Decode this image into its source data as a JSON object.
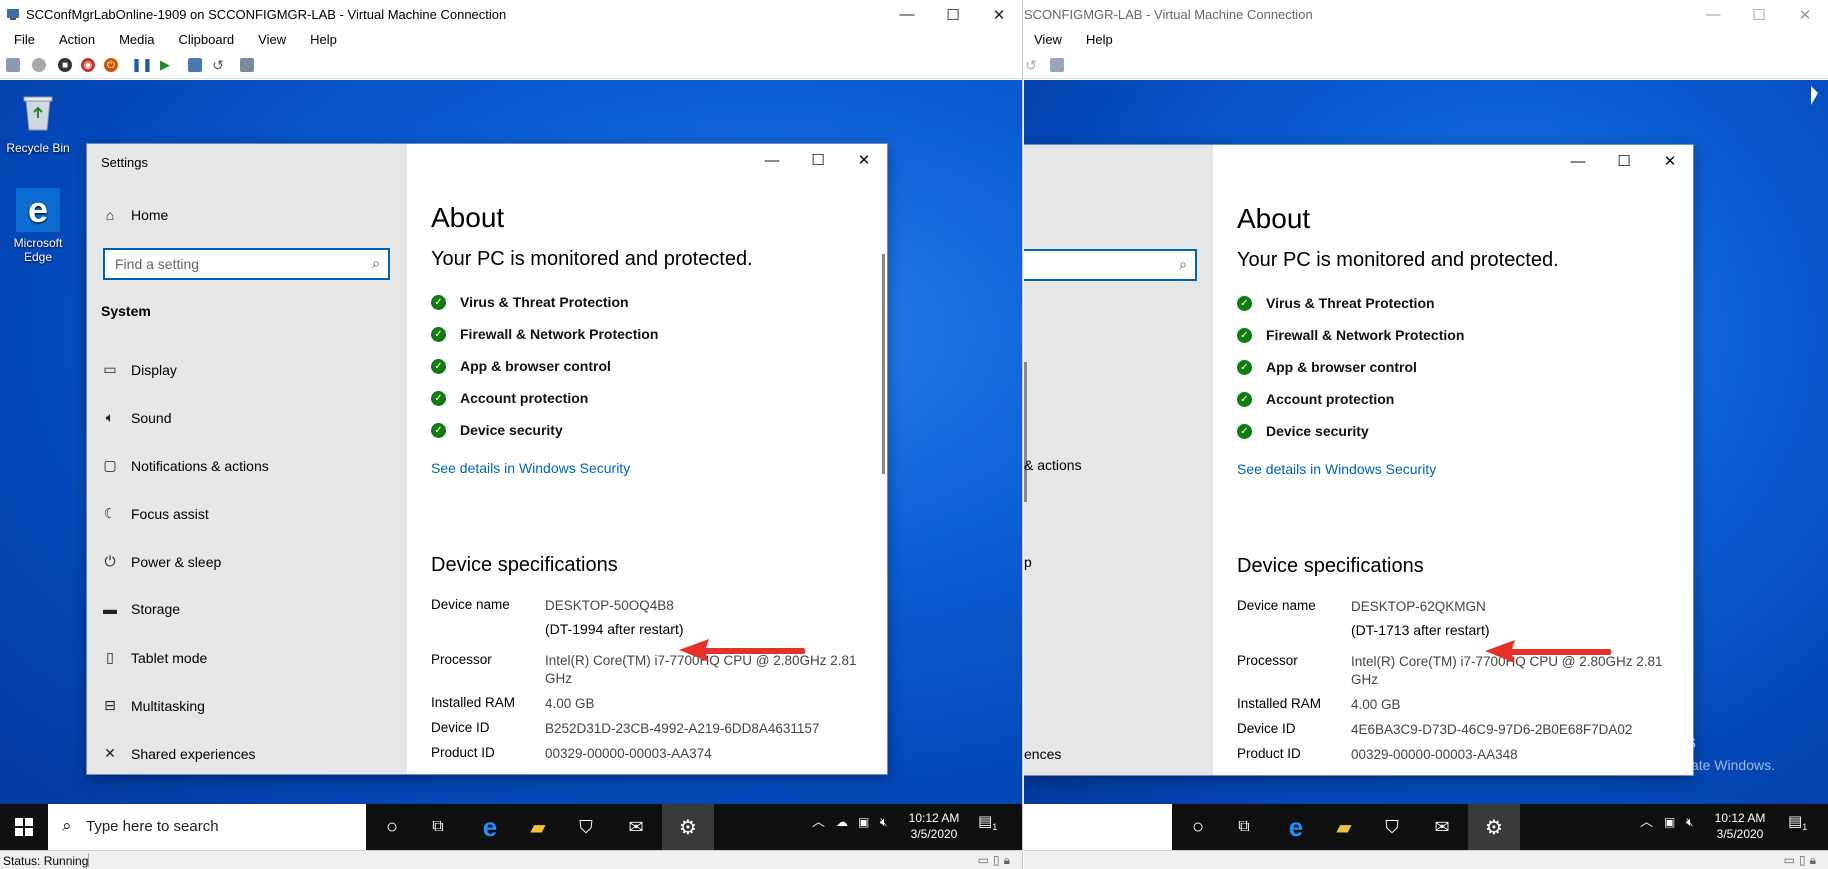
{
  "left_vm": {
    "window_title": "SCConfMgrLabOnline-1909 on SCCONFIGMGR-LAB - Virtual Machine Connection",
    "menu": [
      "File",
      "Action",
      "Media",
      "Clipboard",
      "View",
      "Help"
    ],
    "desktop_icons": [
      {
        "label_line1": "Recycle Bin",
        "label_line2": "",
        "icon": "recycle-bin-icon"
      },
      {
        "label_line1": "Microsoft",
        "label_line2": "Edge",
        "icon": "edge-icon"
      }
    ],
    "settings": {
      "app_title": "Settings",
      "home": "Home",
      "search_placeholder": "Find a setting",
      "section": "System",
      "nav": [
        {
          "label": "Display",
          "icon": "monitor-icon"
        },
        {
          "label": "Sound",
          "icon": "speaker-icon"
        },
        {
          "label": "Notifications & actions",
          "icon": "notification-icon"
        },
        {
          "label": "Focus assist",
          "icon": "moon-icon"
        },
        {
          "label": "Power & sleep",
          "icon": "power-icon"
        },
        {
          "label": "Storage",
          "icon": "storage-icon"
        },
        {
          "label": "Tablet mode",
          "icon": "tablet-icon"
        },
        {
          "label": "Multitasking",
          "icon": "multitasking-icon"
        },
        {
          "label": "Shared experiences",
          "icon": "shared-icon"
        }
      ],
      "about_title": "About",
      "protection_heading": "Your PC is monitored and protected.",
      "protections": [
        "Virus & Threat Protection",
        "Firewall & Network Protection",
        "App & browser control",
        "Account protection",
        "Device security"
      ],
      "security_link": "See details in Windows Security",
      "specs_heading": "Device specifications",
      "specs": {
        "device_name_label": "Device name",
        "device_name": "DESKTOP-50OQ4B8",
        "device_note": "(DT-1994 after restart)",
        "processor_label": "Processor",
        "processor_line1": "Intel(R) Core(TM) i7-7700HQ CPU @ 2.80GHz   2.81",
        "processor_line2": "GHz",
        "ram_label": "Installed RAM",
        "ram": "4.00 GB",
        "device_id_label": "Device ID",
        "device_id": "B252D31D-23CB-4992-A219-6DD8A4631157",
        "product_id_label": "Product ID",
        "product_id": "00329-00000-00003-AA374"
      }
    },
    "taskbar": {
      "search_placeholder": "Type here to search",
      "time": "10:12 AM",
      "date": "3/5/2020",
      "notif_count": "1"
    },
    "status": "Status: Running"
  },
  "right_vm": {
    "window_title": "SCONFIGMGR-LAB - Virtual Machine Connection",
    "menu": [
      "View",
      "Help"
    ],
    "settings": {
      "nav_partial_1": "& actions",
      "nav_partial_2": "p",
      "nav_partial_3": "ences",
      "about_title": "About",
      "protection_heading": "Your PC is monitored and protected.",
      "protections": [
        "Virus & Threat Protection",
        "Firewall & Network Protection",
        "App & browser control",
        "Account protection",
        "Device security"
      ],
      "security_link": "See details in Windows Security",
      "specs_heading": "Device specifications",
      "specs": {
        "device_name_label": "Device name",
        "device_name": "DESKTOP-62QKMGN",
        "device_note": "(DT-1713 after restart)",
        "processor_label": "Processor",
        "processor_line1": "Intel(R) Core(TM) i7-7700HQ CPU @ 2.80GHz   2.81",
        "processor_line2": "GHz",
        "ram_label": "Installed RAM",
        "ram": "4.00 GB",
        "device_id_label": "Device ID",
        "device_id": "4E6BA3C9-D73D-46C9-97D6-2B0E68F7DA02",
        "product_id_label": "Product ID",
        "product_id": "00329-00000-00003-AA348"
      }
    },
    "watermark": {
      "title": "Activate Windows",
      "subtitle": "Go to Settings to activate Windows."
    },
    "taskbar": {
      "time": "10:12 AM",
      "date": "3/5/2020",
      "notif_count": "1"
    }
  },
  "colors": {
    "accent": "#0063b1",
    "check_green": "#107c10",
    "arrow_red": "#e8302a"
  }
}
